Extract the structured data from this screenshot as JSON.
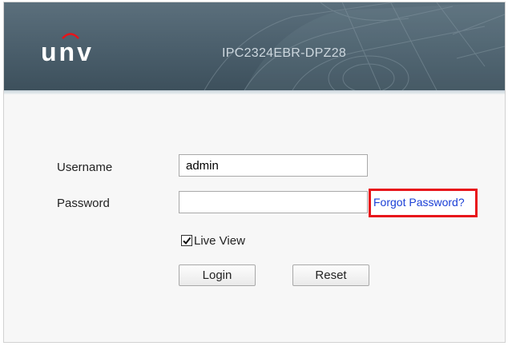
{
  "header": {
    "brand_logo_text": "unv",
    "model_name": "IPC2324EBR-DPZ28"
  },
  "form": {
    "username_label": "Username",
    "username_value": "admin",
    "password_label": "Password",
    "password_value": "",
    "forgot_password_label": "Forgot Password?",
    "live_view_label": "Live View",
    "live_view_checked": true,
    "login_button_label": "Login",
    "reset_button_label": "Reset"
  },
  "colors": {
    "header_background": "#4a5e6b",
    "page_background": "#f7f7f7",
    "link": "#1a3fd6",
    "highlight_border": "#e8141a"
  },
  "icons": {
    "checkbox": "checkmark-icon"
  }
}
